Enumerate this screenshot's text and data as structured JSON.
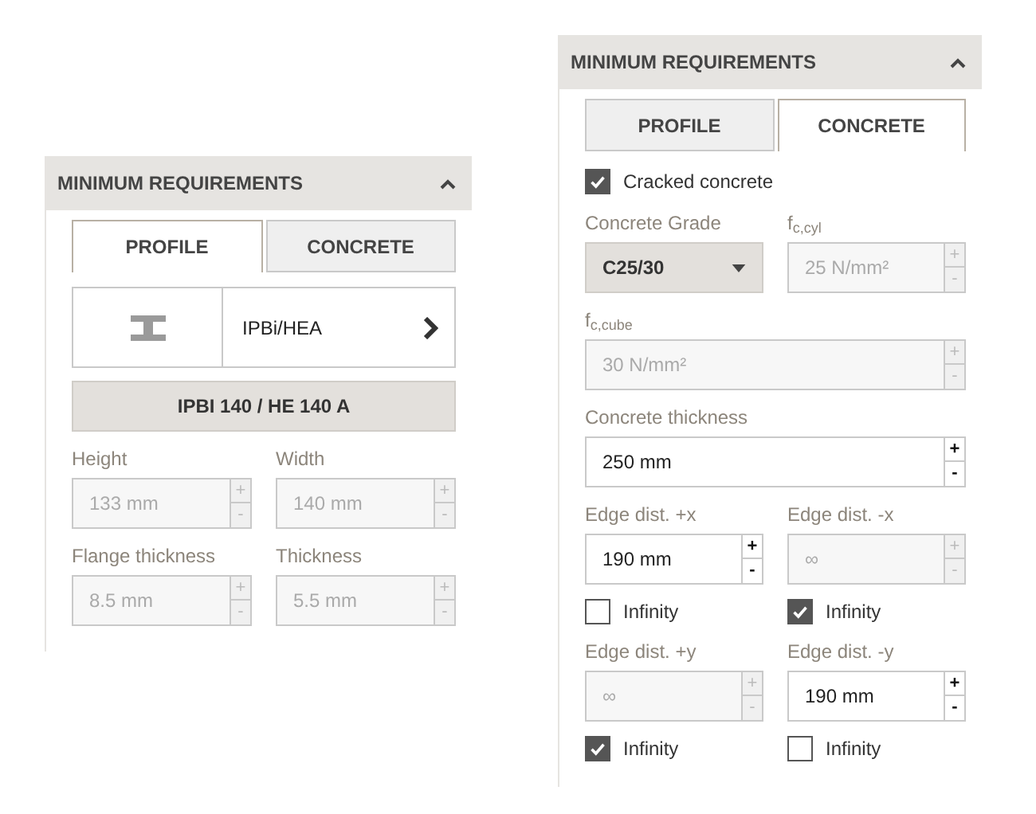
{
  "panels": [
    {
      "title": "MINIMUM REQUIREMENTS",
      "expanded": true,
      "tabs": [
        {
          "label": "PROFILE",
          "selected": true
        },
        {
          "label": "CONCRETE",
          "selected": false
        }
      ],
      "rows": [
        [
          {
            "kind": "profile_picker",
            "label": "IPBi/HEA"
          }
        ],
        [
          {
            "kind": "profile_button",
            "label": "IPBI 140 / HE 140 A"
          }
        ],
        [
          {
            "kind": "field",
            "label": "Height",
            "value": "133 mm",
            "disabled": true,
            "increment": "+",
            "decrement": "-"
          },
          {
            "kind": "field",
            "label": "Width",
            "value": "140 mm",
            "disabled": true,
            "increment": "+",
            "decrement": "-"
          }
        ],
        [
          {
            "kind": "field",
            "label": "Flange thickness",
            "value": "8.5 mm",
            "disabled": true,
            "increment": "+",
            "decrement": "-"
          },
          {
            "kind": "field",
            "label": "Thickness",
            "value": "5.5 mm",
            "disabled": true,
            "increment": "+",
            "decrement": "-"
          }
        ]
      ]
    },
    {
      "title": "MINIMUM REQUIREMENTS",
      "expanded": true,
      "tabs": [
        {
          "label": "PROFILE",
          "selected": false
        },
        {
          "label": "CONCRETE",
          "selected": true
        }
      ],
      "rows": [
        [
          {
            "kind": "checkbox",
            "label": "Cracked concrete",
            "checked": true
          }
        ],
        [
          {
            "kind": "select",
            "label": "Concrete Grade",
            "value": "C25/30"
          },
          {
            "kind": "field",
            "label": "f$_{c,cyl}$",
            "value": "25 N/mm²",
            "disabled": true,
            "increment": "+",
            "decrement": "-"
          }
        ],
        [
          {
            "kind": "field",
            "label": "f$_{c,cube}$",
            "value": "30 N/mm²",
            "disabled": true,
            "increment": "+",
            "decrement": "-"
          }
        ],
        [
          {
            "kind": "field",
            "label": "Concrete thickness",
            "value": "250 mm",
            "disabled": false,
            "increment": "+",
            "decrement": "-"
          }
        ],
        [
          {
            "kind": "field",
            "label": "Edge dist. +x",
            "value": "190 mm",
            "disabled": false,
            "increment": "+",
            "decrement": "-",
            "infinity": {
              "label": "Infinity",
              "checked": false
            }
          },
          {
            "kind": "field",
            "label": "Edge dist. -x",
            "value": "∞",
            "disabled": true,
            "increment": "+",
            "decrement": "-",
            "infinity": {
              "label": "Infinity",
              "checked": true
            }
          }
        ],
        [
          {
            "kind": "field",
            "label": "Edge dist. +y",
            "value": "∞",
            "disabled": true,
            "increment": "+",
            "decrement": "-",
            "infinity": {
              "label": "Infinity",
              "checked": true
            }
          },
          {
            "kind": "field",
            "label": "Edge dist. -y",
            "value": "190 mm",
            "disabled": false,
            "increment": "+",
            "decrement": "-",
            "infinity": {
              "label": "Infinity",
              "checked": false
            }
          }
        ]
      ]
    }
  ]
}
